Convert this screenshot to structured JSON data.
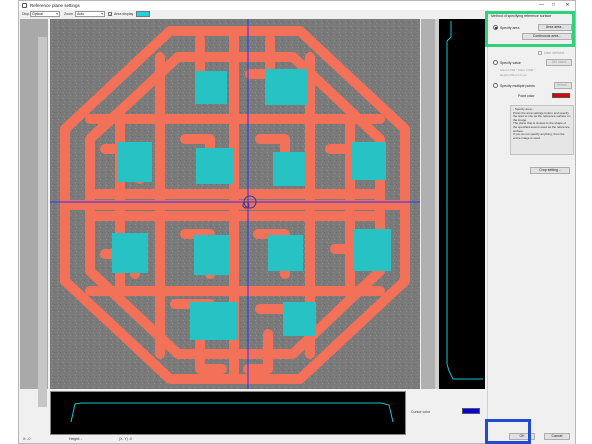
{
  "window": {
    "title": "Reference plane settings",
    "minimize_glyph": "—",
    "maximize_glyph": "□",
    "close_glyph": "✕"
  },
  "toolbar": {
    "label1": "Disp.",
    "select1_value": "Optical",
    "label2": "Zoom",
    "select2_value": "Auto",
    "area_display_label": "Area display",
    "area_display_checked": true,
    "area_display_color": "#27d0e0"
  },
  "panel": {
    "method_title": "Method of specifying reference surface",
    "specify_area_label": "Specify area",
    "area_button": "Area area...",
    "continuous_area_button": "Continuous area...",
    "user_defined_label": "User defined",
    "specify_value_label": "Specify value",
    "set_value_button": "Set value",
    "value_line1": "Slant      0.000  °  Slant      0.000  °",
    "value_line2": "Height offset  0.0 µm",
    "specify_multiple_label": "Specify multiple points",
    "select_button": "Select...",
    "point_color_label": "Point color",
    "point_color": "#e00000",
    "desc_title": "- Specify area -",
    "desc_lines": [
      "Press the area settings button and specify",
      "the area to use as the reference surface on",
      "the image.",
      "The plane that is closest to the shape of",
      "the specified area is used as the reference",
      "surface.",
      "If you do not specify anything, then the",
      "entire image is used."
    ],
    "crop_button": "Crop setting...",
    "ok_button": "OK",
    "cancel_button": "Cancel"
  },
  "bottom": {
    "cursor_color_label": "Cursor color",
    "cursor_color": "#0000e0"
  },
  "status": {
    "item1": "X: -0",
    "item2": "Height: -",
    "item3": "(X, Y) -0"
  },
  "colors": {
    "highlight_method": "#2fd27a",
    "highlight_ok": "#1f4bd1",
    "part_fill": "#f27158",
    "region_fill": "#27c2c4",
    "crosshair": "#3030ff"
  }
}
